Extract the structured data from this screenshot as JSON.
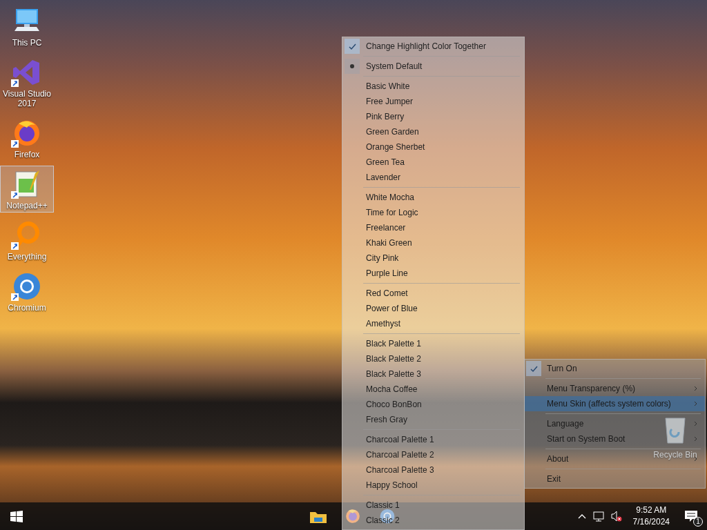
{
  "desktop_icons": [
    {
      "label": "This PC",
      "kind": "computer",
      "shortcut": false,
      "selected": false
    },
    {
      "label": "Visual Studio 2017",
      "kind": "studio",
      "shortcut": true,
      "selected": false
    },
    {
      "label": "Firefox",
      "kind": "firefox",
      "shortcut": true,
      "selected": false
    },
    {
      "label": "Notepad++",
      "kind": "notepad",
      "shortcut": true,
      "selected": true
    },
    {
      "label": "Everything",
      "kind": "magnifier",
      "shortcut": true,
      "selected": false
    },
    {
      "label": "Chromium",
      "kind": "chromium",
      "shortcut": true,
      "selected": false
    }
  ],
  "recycle_bin": {
    "label": "Recycle Bin"
  },
  "skin_menu": {
    "highlight_toggle": {
      "label": "Change Highlight Color Together",
      "checked": true
    },
    "groups": [
      [
        {
          "label": "System Default",
          "selected": true
        }
      ],
      [
        {
          "label": "Basic White",
          "selected": false
        },
        {
          "label": "Free Jumper",
          "selected": false
        },
        {
          "label": "Pink Berry",
          "selected": false
        },
        {
          "label": "Green Garden",
          "selected": false
        },
        {
          "label": "Orange Sherbet",
          "selected": false
        },
        {
          "label": "Green Tea",
          "selected": false
        },
        {
          "label": "Lavender",
          "selected": false
        }
      ],
      [
        {
          "label": "White Mocha",
          "selected": false
        },
        {
          "label": "Time for Logic",
          "selected": false
        },
        {
          "label": "Freelancer",
          "selected": false
        },
        {
          "label": "Khaki Green",
          "selected": false
        },
        {
          "label": "City Pink",
          "selected": false
        },
        {
          "label": "Purple Line",
          "selected": false
        }
      ],
      [
        {
          "label": "Red Comet",
          "selected": false
        },
        {
          "label": "Power of Blue",
          "selected": false
        },
        {
          "label": "Amethyst",
          "selected": false
        }
      ],
      [
        {
          "label": "Black Palette 1",
          "selected": false
        },
        {
          "label": "Black Palette 2",
          "selected": false
        },
        {
          "label": "Black Palette 3",
          "selected": false
        },
        {
          "label": "Mocha Coffee",
          "selected": false
        },
        {
          "label": "Choco BonBon",
          "selected": false
        },
        {
          "label": "Fresh Gray",
          "selected": false
        }
      ],
      [
        {
          "label": "Charcoal Palette 1",
          "selected": false
        },
        {
          "label": "Charcoal Palette 2",
          "selected": false
        },
        {
          "label": "Charcoal Palette 3",
          "selected": false
        },
        {
          "label": "Happy School",
          "selected": false
        }
      ],
      [
        {
          "label": "Classic 1",
          "selected": false
        },
        {
          "label": "Classic 2",
          "selected": false
        }
      ]
    ]
  },
  "tray_menu": {
    "groups": [
      [
        {
          "label": "Turn On",
          "checked": true,
          "submenu": false,
          "highlighted": false
        }
      ],
      [
        {
          "label": "Menu Transparency (%)",
          "checked": false,
          "submenu": true,
          "highlighted": false
        },
        {
          "label": "Menu Skin (affects system colors)",
          "checked": false,
          "submenu": true,
          "highlighted": true
        }
      ],
      [
        {
          "label": "Language",
          "checked": false,
          "submenu": true,
          "highlighted": false
        },
        {
          "label": "Start on System Boot",
          "checked": false,
          "submenu": true,
          "highlighted": false
        }
      ],
      [
        {
          "label": "About",
          "checked": false,
          "submenu": true,
          "highlighted": false
        }
      ],
      [
        {
          "label": "Exit",
          "checked": false,
          "submenu": false,
          "highlighted": false
        }
      ]
    ]
  },
  "taskbar": {
    "apps": [
      {
        "kind": "folder"
      },
      {
        "kind": "firefox"
      },
      {
        "kind": "chromium"
      }
    ],
    "clock": {
      "time": "9:52 AM",
      "date": "7/16/2024"
    },
    "notifications": {
      "count": "1"
    }
  }
}
